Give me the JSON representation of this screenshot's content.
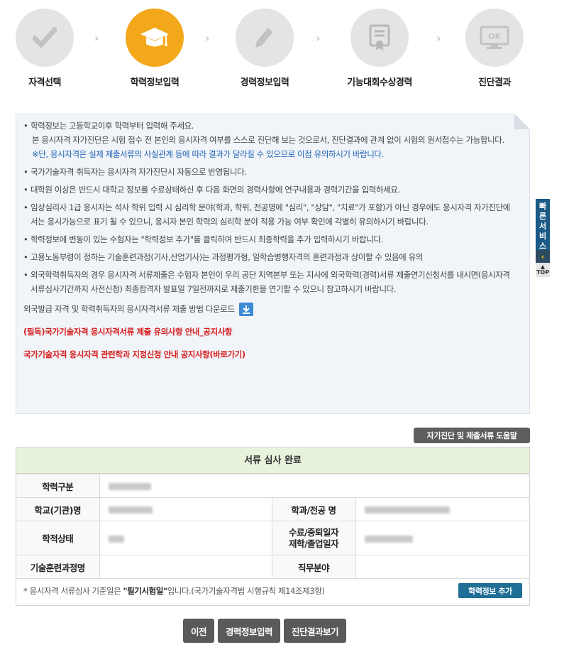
{
  "colors": {
    "active_step": "#f3a81c",
    "inactive_step": "#e4e4e4",
    "result_header": "#e8f3dc",
    "notice_red": "#d81e1e",
    "notice_blue": "#1a5fb4"
  },
  "steps": [
    {
      "label": "자격선택",
      "icon": "check-icon",
      "active": false
    },
    {
      "label": "학력정보입력",
      "icon": "graduation-cap-icon",
      "active": true
    },
    {
      "label": "경력정보입력",
      "icon": "pencil-icon",
      "active": false
    },
    {
      "label": "기능대회수상경력",
      "icon": "certificate-icon",
      "active": false
    },
    {
      "label": "진단결과",
      "icon": "monitor-ok-icon",
      "active": false
    }
  ],
  "step_icon_text": {
    "ok": "OK"
  },
  "notice": {
    "item1_line1": "학력정보는 고등학교이후 학력부터 입력해 주세요.",
    "item1_line2": "본 응시자격 자가진단은 시험 접수 전 본인의 응시자격 여부를 스스로 진단해 보는 것으로서, 진단결과에 관계 없이 시험의 원서접수는 가능합니다.",
    "item1_blue": "※단, 응시자격은 실제 제출서류의 사실관계 등에 따라 결과가 달라질 수 있으므로 이점 유의하시기 바랍니다.",
    "item2": "국가기술자격 취득자는 응시자격 자가진단시 자동으로 반영됩니다.",
    "item3": "대학원 이상은 반드시 대학교 정보를 수료상태하신 후 다음 화면의 경력사항에 연구내용과 경력기간을 입력하세요.",
    "item4": "임상심리사 1급 응시자는 석사 학위 입력 시 심리학 분야(학과, 학위, 전공명에 \"심리\", \"상담\", \"치료\"가 포함)가 아닌 경우에도 응시자격 자가진단에서는 응시가능으로 표기 될 수 있으니, 응시자 본인 학력의 심리학 분야 적용 가능 여부 확인에 각별히 유의하시기 바랍니다.",
    "item5": "학력정보에 변동이 있는 수험자는 \"학력정보 추가\"를 클릭하여 반드시 최종학력을 추가 입력하시기 바랍니다.",
    "item6": "고용노동부령이 정하는 기술훈련과정(기사,산업기사)는 과정평가형, 일학습병행자격의 훈련과정과 상이할 수 있음에 유의",
    "item7": "외국학력취득자의 경우 응시자격 서류제출은 수험자 본인이 우리 공단 지역본부 또는 지사에 외국학력(경력)서류 제출연기신청서를 내시면(응시자격 서류심사기간까지 사전신청) 최종합격자 발표일 7일전까지로 제출기한을 연기할 수 있으니 참고하시기 바랍니다.",
    "download_text": "외국발급 자격 및 학력취득자의 응시자격서류 제출 방법 다운로드",
    "red_link1": "(필독)국가기술자격 응시자격서류 제출 유의사항 안내_공지사항",
    "red_link2": "국가기술자격 응시자격 관련학과 지정신청 안내 공지사항(바로가기)"
  },
  "help_button": "자기진단 및 제출서류 도움말",
  "result": {
    "header": "서류 심사 완료",
    "labels": {
      "edu_type": "학력구분",
      "school": "학교(기관)명",
      "major": "학과/전공 명",
      "status": "학적상태",
      "date_line1": "수료/중퇴일자",
      "date_line2": "재학/졸업일자",
      "training": "기술훈련과정명",
      "job_field": "직무분야"
    },
    "note_prefix": "* 응시자격 서류심사 기준일은 ",
    "note_bold": "\"필기시험일\"",
    "note_suffix": "입니다.(국가기술자격법 시행규칙 제14조제3항)",
    "add_button": "학력정보 추가"
  },
  "bottom_buttons": {
    "prev": "이전",
    "career": "경력정보입력",
    "diagnose": "진단결과보기"
  },
  "quick_service": {
    "label": "빠른서비스",
    "top": "TOP"
  }
}
